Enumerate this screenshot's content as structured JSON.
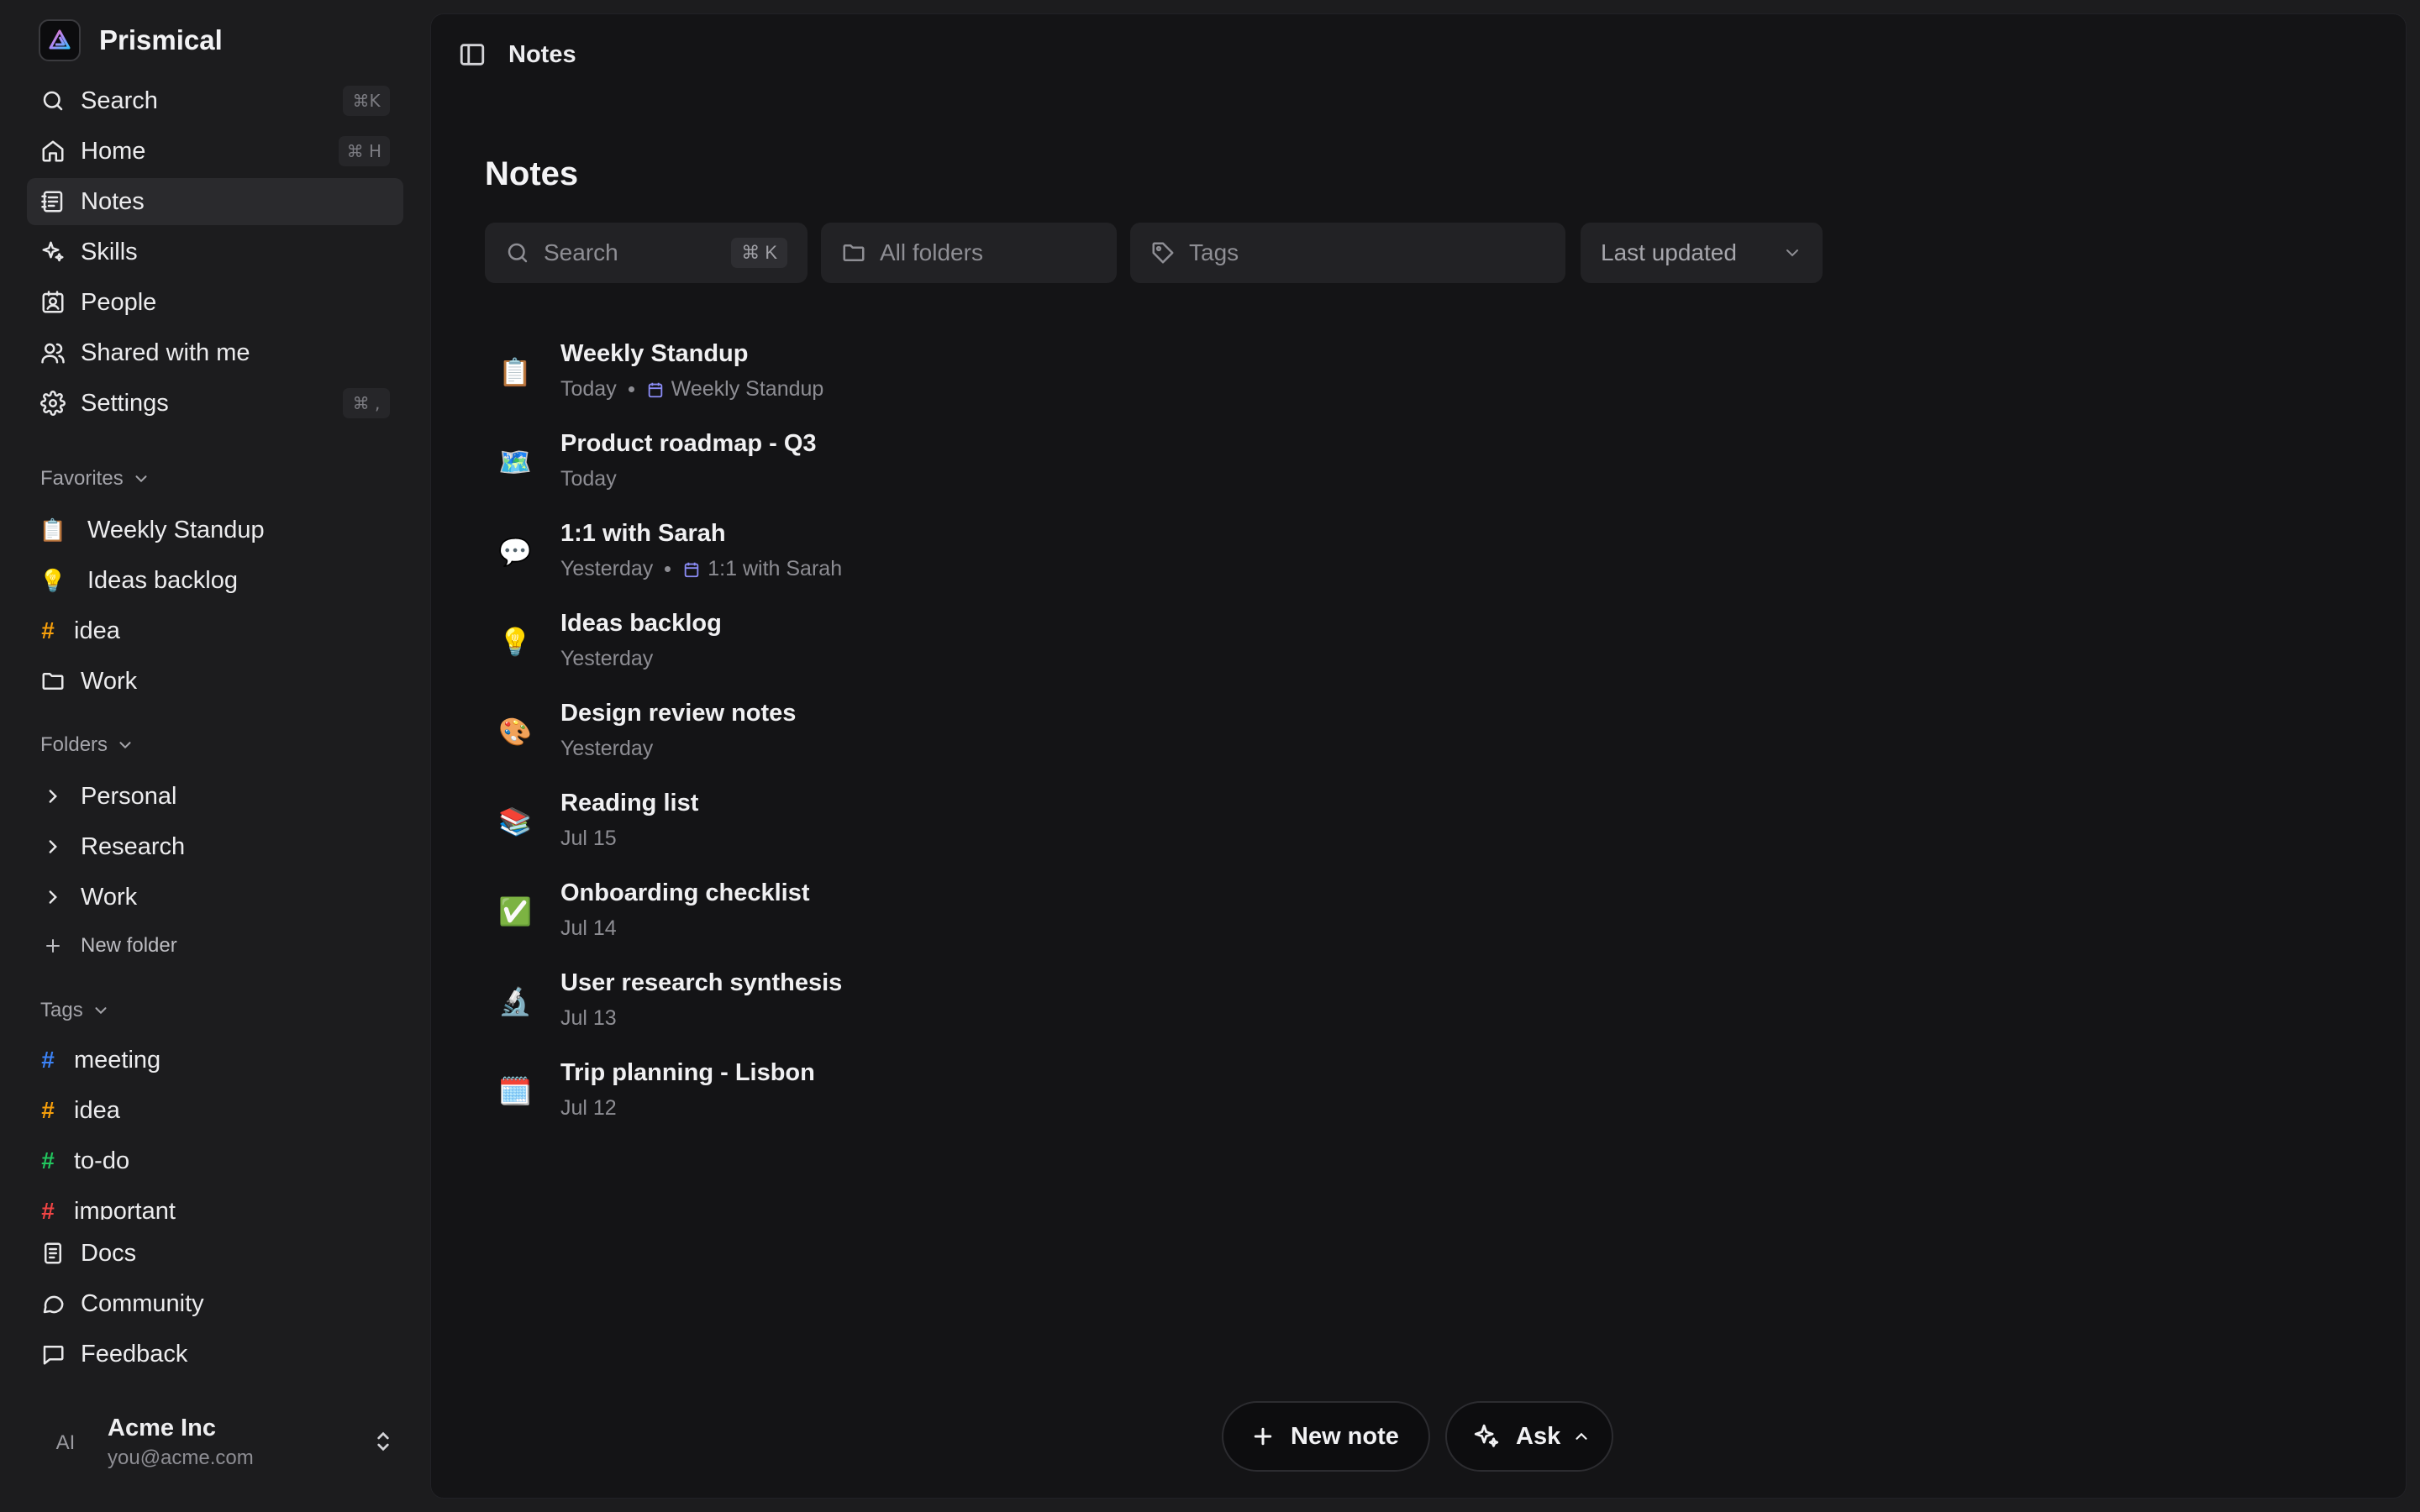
{
  "brand": {
    "name": "Prismical"
  },
  "nav": [
    {
      "label": "Search",
      "icon": "search-icon",
      "shortcut": "⌘K"
    },
    {
      "label": "Home",
      "icon": "home-icon",
      "shortcut": "⌘ H"
    },
    {
      "label": "Notes",
      "icon": "notes-icon",
      "active": true
    },
    {
      "label": "Skills",
      "icon": "sparkles-icon"
    },
    {
      "label": "People",
      "icon": "contact-card-icon"
    },
    {
      "label": "Shared with me",
      "icon": "users-icon"
    },
    {
      "label": "Settings",
      "icon": "gear-icon",
      "shortcut": "⌘ ,"
    }
  ],
  "favorites": {
    "title": "Favorites",
    "items": [
      {
        "label": "Weekly Standup",
        "emoji": "📋"
      },
      {
        "label": "Ideas backlog",
        "emoji": "💡"
      },
      {
        "label": "idea",
        "hash": "#",
        "color": "#f59e0b"
      },
      {
        "label": "Work",
        "icon": "folder-icon"
      }
    ]
  },
  "folders": {
    "title": "Folders",
    "items": [
      {
        "label": "Personal"
      },
      {
        "label": "Research"
      },
      {
        "label": "Work"
      }
    ],
    "new_label": "New folder"
  },
  "tags": {
    "title": "Tags",
    "items": [
      {
        "label": "meeting",
        "color": "#3b82f6"
      },
      {
        "label": "idea",
        "color": "#f59e0b"
      },
      {
        "label": "to-do",
        "color": "#22c55e"
      },
      {
        "label": "important",
        "color": "#ef4444"
      }
    ]
  },
  "footer_links": [
    {
      "label": "Docs",
      "icon": "book-icon"
    },
    {
      "label": "Community",
      "icon": "chat-bubble-icon"
    },
    {
      "label": "Feedback",
      "icon": "message-square-icon"
    }
  ],
  "account": {
    "initials": "AI",
    "name": "Acme Inc",
    "email": "you@acme.com"
  },
  "main": {
    "breadcrumb": "Notes",
    "title": "Notes",
    "filters": {
      "search_placeholder": "Search",
      "search_shortcut": "⌘  K",
      "folders": "All folders",
      "tags": "Tags",
      "sort": "Last updated"
    },
    "notes": [
      {
        "emoji": "📋",
        "title": "Weekly Standup",
        "date": "Today",
        "event": "Weekly Standup"
      },
      {
        "emoji": "🗺️",
        "title": "Product roadmap - Q3",
        "date": "Today"
      },
      {
        "emoji": "💬",
        "title": "1:1 with Sarah",
        "date": "Yesterday",
        "event": "1:1 with Sarah"
      },
      {
        "emoji": "💡",
        "title": "Ideas backlog",
        "date": "Yesterday"
      },
      {
        "emoji": "🎨",
        "title": "Design review notes",
        "date": "Yesterday"
      },
      {
        "emoji": "📚",
        "title": "Reading list",
        "date": "Jul 15"
      },
      {
        "emoji": "✅",
        "title": "Onboarding checklist",
        "date": "Jul 14"
      },
      {
        "emoji": "🔬",
        "title": "User research synthesis",
        "date": "Jul 13"
      },
      {
        "emoji": "🗓️",
        "title": "Trip planning - Lisbon",
        "date": "Jul 12"
      }
    ],
    "actions": {
      "new_note": "New note",
      "ask": "Ask"
    }
  },
  "colors": {
    "accent_calendar": "#8b8cf6",
    "active_bg": "#2a2a2d"
  }
}
